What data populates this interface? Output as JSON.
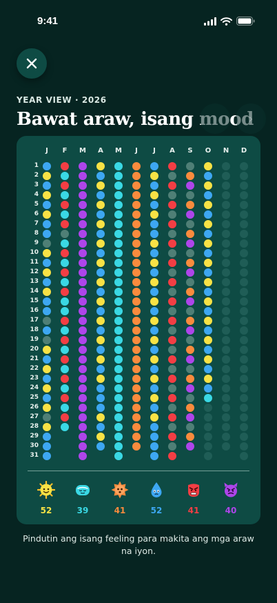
{
  "status_bar": {
    "time": "9:41"
  },
  "header": {
    "label": "YEAR VIEW · 2026",
    "title": "Bawat araw, isang mood",
    "next_glyph": "›"
  },
  "calendar": {
    "months": [
      "J",
      "F",
      "M",
      "A",
      "M",
      "J",
      "J",
      "A",
      "S",
      "O",
      "N",
      "D"
    ],
    "month_lengths": [
      31,
      28,
      31,
      30,
      31,
      30,
      31,
      31,
      30,
      31,
      30,
      31
    ],
    "days": [
      "1",
      "2",
      "3",
      "4",
      "5",
      "6",
      "7",
      "8",
      "9",
      "10",
      "11",
      "12",
      "13",
      "14",
      "15",
      "16",
      "17",
      "18",
      "19",
      "20",
      "21",
      "22",
      "23",
      "24",
      "25",
      "26",
      "27",
      "28",
      "29",
      "30",
      "31"
    ],
    "mood_colors": {
      "Y": "#f8e245",
      "T": "#3ad8e4",
      "O": "#fa8b3d",
      "B": "#3da7f2",
      "R": "#f33e44",
      "P": "#ae45ea",
      "N": "#4f7f76",
      "E": "#1f5d56"
    },
    "columns": [
      "BYBYBYBBNYBYBYBBNBNYBYBYBYNYBBB",
      "RTRTRTRNTRTRTRTTRTRTRTRTRTRT",
      "PPPPPPPPPPPPPPPPPPPPPPPPPPPPPPP",
      "YBYBYBYBYBYBYBYBYBYBYBYBBBYBYB",
      "TTTTTTTTTTTTTTTTTTTTTTTTTTTTTTT",
      "OOOOOOOOOOOOOOOOOOOOOOOOOOOOOO",
      "BYBYBYBBYBYBYBYBYBYBYBYBYBYBBBB",
      "RNRNRNRNRNRNRNRNRNRNRNRNRNRNRNR",
      "NOPNOPNOPNOPNOPNOPNOPNOPNOPNOP",
      "YBYBYBYBYBYBYBYBYBYBYBYBTEEEEEE",
      "EEEEEEEEEEEEEEEEEEEEEEEEEEEEEE",
      "EEEEEEEEEEEEEEEEEEEEEEEEEEEEEEE"
    ]
  },
  "moods": [
    {
      "name": "sun",
      "count": "52",
      "color": "#f8e245"
    },
    {
      "name": "calm",
      "count": "39",
      "color": "#3ad8e4"
    },
    {
      "name": "burst",
      "count": "41",
      "color": "#fa8b3d"
    },
    {
      "name": "drop",
      "count": "52",
      "color": "#3da7f2"
    },
    {
      "name": "angry",
      "count": "41",
      "color": "#f33e44"
    },
    {
      "name": "devil",
      "count": "40",
      "color": "#ae45ea"
    }
  ],
  "footer": {
    "hint": "Pindutin ang isang feeling para makita ang mga araw na iyon."
  }
}
